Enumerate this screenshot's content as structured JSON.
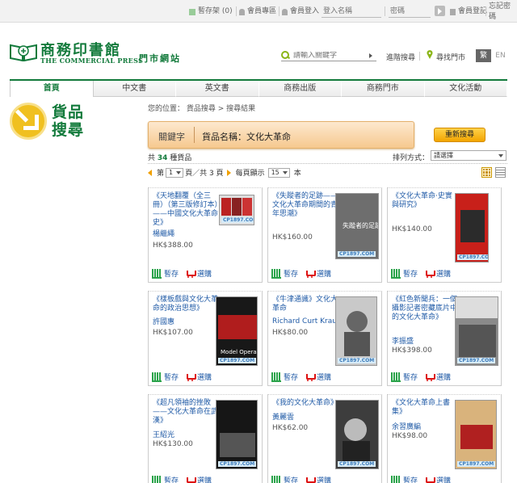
{
  "topbar": {
    "shelf": "暫存架 (0)",
    "member_area": "會員專區",
    "member_login": "會員登入",
    "login_placeholder": "登入名稱",
    "password_placeholder": "密碼",
    "register": "會員登記",
    "forgot": "忘記密碼"
  },
  "header": {
    "logo_cn": "商務印書館",
    "logo_en": "THE COMMERCIAL PRESS",
    "logo_sub": "門市網站",
    "search_placeholder": "請輸入關鍵字",
    "advanced_search": "進階搜尋",
    "find_store": "尋找門市",
    "lang_tc": "繁",
    "lang_en": "EN",
    "brand_color": "#127a3b"
  },
  "nav": {
    "tabs": [
      {
        "label": "首頁",
        "active": true
      },
      {
        "label": "中文書",
        "active": false
      },
      {
        "label": "英文書",
        "active": false
      },
      {
        "label": "商務出版",
        "active": false
      },
      {
        "label": "商務門市",
        "active": false
      },
      {
        "label": "文化活動",
        "active": false
      }
    ]
  },
  "side": {
    "title": "貨品搜尋"
  },
  "main": {
    "breadcrumb": "您的位置： 貨品搜尋 > 搜尋結果",
    "keyword_label": "關鍵字",
    "keyword_value": "貨品名稱：文化大革命",
    "reset_button": "重新搜尋",
    "count_prefix": "共",
    "count": "34",
    "count_suffix": "種貨品",
    "sort_label": "排列方式：",
    "sort_value": "請選擇",
    "pager": {
      "page_label": "第",
      "page_value": "1",
      "page_total": "頁／共 3 頁",
      "per_page_label": "每頁顯示",
      "per_page_value": "15",
      "per_page_unit": "本"
    },
    "save_label": "暫存",
    "buy_label": "選購",
    "cover_badge": "CP1897.COM"
  },
  "products": [
    {
      "title": "《天地翻覆（全三冊）（第三版修訂本）——中國文化大革命史》",
      "author": "楊繼繩",
      "price": "HK$388.00"
    },
    {
      "title": "《失蹤者的足跡——文化大革命期間的青年思潮》",
      "author": "",
      "price": "HK$160.00"
    },
    {
      "title": "《文化大革命‧史實與研究》",
      "author": "",
      "price": "HK$140.00"
    },
    {
      "title": "《樣板戲與文化大革命的政治思想》",
      "author": "許國惠",
      "price": "HK$107.00"
    },
    {
      "title": "《牛津通識》文化大革命",
      "author": "Richard Curt Kraus",
      "price": "HK$80.00"
    },
    {
      "title": "《紅色新聞兵：一個攝影記者密藏底片中的文化大革命》",
      "author": "李振盛",
      "price": "HK$398.00"
    },
    {
      "title": "《超凡領袖的挫敗——文化大革命在武漢》",
      "author": "王紹光",
      "price": "HK$130.00"
    },
    {
      "title": "《我的文化大革命》",
      "author": "黃麗雲",
      "price": "HK$62.00"
    },
    {
      "title": "《文化大革命上書集》",
      "author": "余習廣編",
      "price": "HK$98.00"
    }
  ]
}
